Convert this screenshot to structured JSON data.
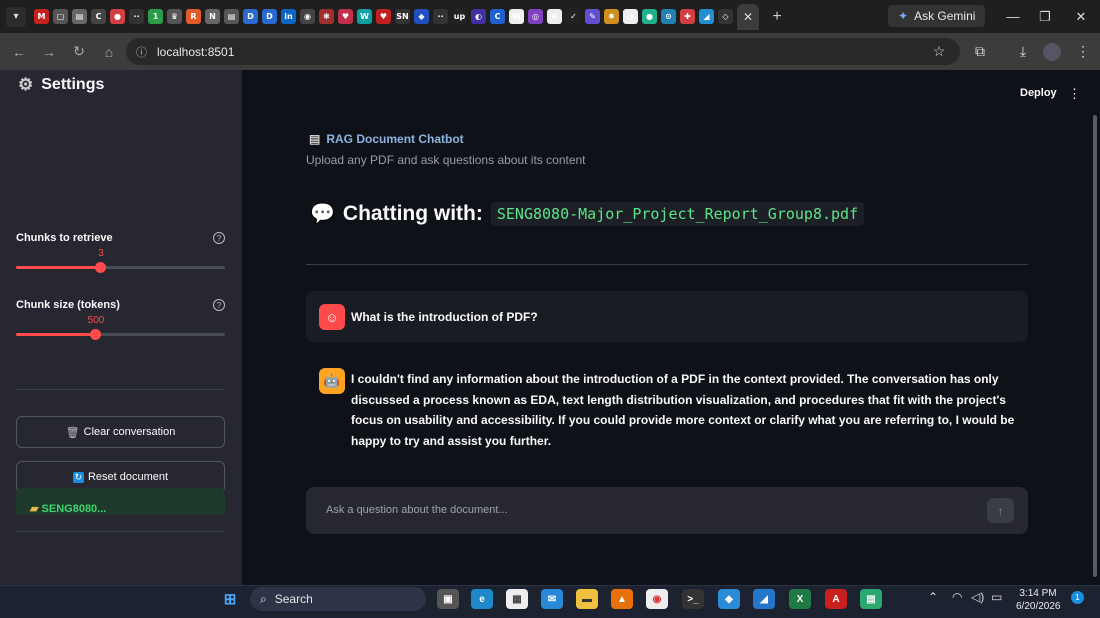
{
  "browser": {
    "url": "localhost:8501",
    "gemini_label": "Ask Gemini",
    "pinned_tabs": [
      {
        "name": "gmail",
        "glyph": "M",
        "color": "#c5221f"
      },
      {
        "name": "tab-2",
        "glyph": "▢",
        "color": "#555"
      },
      {
        "name": "tab-3",
        "glyph": "▤",
        "color": "#666"
      },
      {
        "name": "tab-4",
        "glyph": "C",
        "color": "#444"
      },
      {
        "name": "tab-5",
        "glyph": "●",
        "color": "#d04040"
      },
      {
        "name": "tab-6",
        "glyph": "··",
        "color": "#333"
      },
      {
        "name": "tab-7",
        "glyph": "1",
        "color": "#2a9d4a"
      },
      {
        "name": "tab-8",
        "glyph": "♛",
        "color": "#555"
      },
      {
        "name": "tab-9",
        "glyph": "R",
        "color": "#e05a2a"
      },
      {
        "name": "tab-10",
        "glyph": "N",
        "color": "#666"
      },
      {
        "name": "tab-11",
        "glyph": "▤",
        "color": "#555"
      },
      {
        "name": "tab-12",
        "glyph": "D",
        "color": "#2a6ad0"
      },
      {
        "name": "tab-13",
        "glyph": "D",
        "color": "#2a6ad0"
      },
      {
        "name": "tab-14",
        "glyph": "in",
        "color": "#0a66c2"
      },
      {
        "name": "tab-15",
        "glyph": "◉",
        "color": "#444"
      },
      {
        "name": "tab-16",
        "glyph": "✱",
        "color": "#a03030"
      },
      {
        "name": "tab-17",
        "glyph": "♥",
        "color": "#c0304a"
      },
      {
        "name": "tab-18",
        "glyph": "W",
        "color": "#10a0a0"
      },
      {
        "name": "tab-19",
        "glyph": "♥",
        "color": "#c02020"
      },
      {
        "name": "tab-20",
        "glyph": "SN",
        "color": "#333"
      },
      {
        "name": "tab-21",
        "glyph": "◆",
        "color": "#2050c0"
      },
      {
        "name": "tab-22",
        "glyph": "··",
        "color": "#333"
      },
      {
        "name": "tab-23",
        "glyph": "up",
        "color": "#222"
      },
      {
        "name": "tab-24",
        "glyph": "◐",
        "color": "#4030a0"
      },
      {
        "name": "tab-25",
        "glyph": "C",
        "color": "#2060d0"
      },
      {
        "name": "tab-26",
        "glyph": "W",
        "color": "#eee"
      },
      {
        "name": "tab-27",
        "glyph": "◎",
        "color": "#8040c0"
      },
      {
        "name": "tab-28",
        "glyph": "⊕",
        "color": "#eee"
      },
      {
        "name": "tab-29",
        "glyph": "✓",
        "color": "#222"
      },
      {
        "name": "tab-30",
        "glyph": "✎",
        "color": "#6050d0"
      },
      {
        "name": "tab-31",
        "glyph": "✹",
        "color": "#d09020"
      },
      {
        "name": "tab-32",
        "glyph": "◑",
        "color": "#eee"
      },
      {
        "name": "tab-33",
        "glyph": "●",
        "color": "#20b090"
      },
      {
        "name": "tab-34",
        "glyph": "⊙",
        "color": "#2080b0"
      },
      {
        "name": "tab-35",
        "glyph": "✚",
        "color": "#d04040"
      },
      {
        "name": "tab-36",
        "glyph": "◢",
        "color": "#2090d0"
      },
      {
        "name": "tab-37",
        "glyph": "◇",
        "color": "#333"
      }
    ]
  },
  "sidebar": {
    "title": "Settings",
    "sliders": [
      {
        "label": "Chunks to retrieve",
        "value": "3",
        "fraction": 0.4
      },
      {
        "label": "Chunk size (tokens)",
        "value": "500",
        "fraction": 0.38
      }
    ],
    "clear_label": "Clear conversation",
    "reset_label": "Reset document",
    "doc_card_label": "SENG8080..."
  },
  "main": {
    "deploy_label": "Deploy",
    "app_title": "RAG Document Chatbot",
    "subtitle": "Upload any PDF and ask questions about its content",
    "chat_heading": "Chatting with:",
    "filename": "SENG8080-Major_Project_Report_Group8.pdf",
    "user_message": "What is the introduction of PDF?",
    "assistant_message": "I couldn't find any information about the introduction of a PDF in the context provided. The conversation has only discussed a process known as EDA, text length distribution visualization, and procedures that fit with the project's focus on usability and accessibility. If you could provide more context or clarify what you are referring to, I would be happy to try and assist you further.",
    "input_placeholder": "Ask a question about the document..."
  },
  "taskbar": {
    "search_label": "Search",
    "time": "3:14 PM",
    "date": "6/20/2026",
    "notification_count": "1"
  },
  "colors": {
    "accent": "#ff4b4b",
    "user_avatar": "#ff4b4b",
    "bot_avatar": "#ffa421"
  }
}
